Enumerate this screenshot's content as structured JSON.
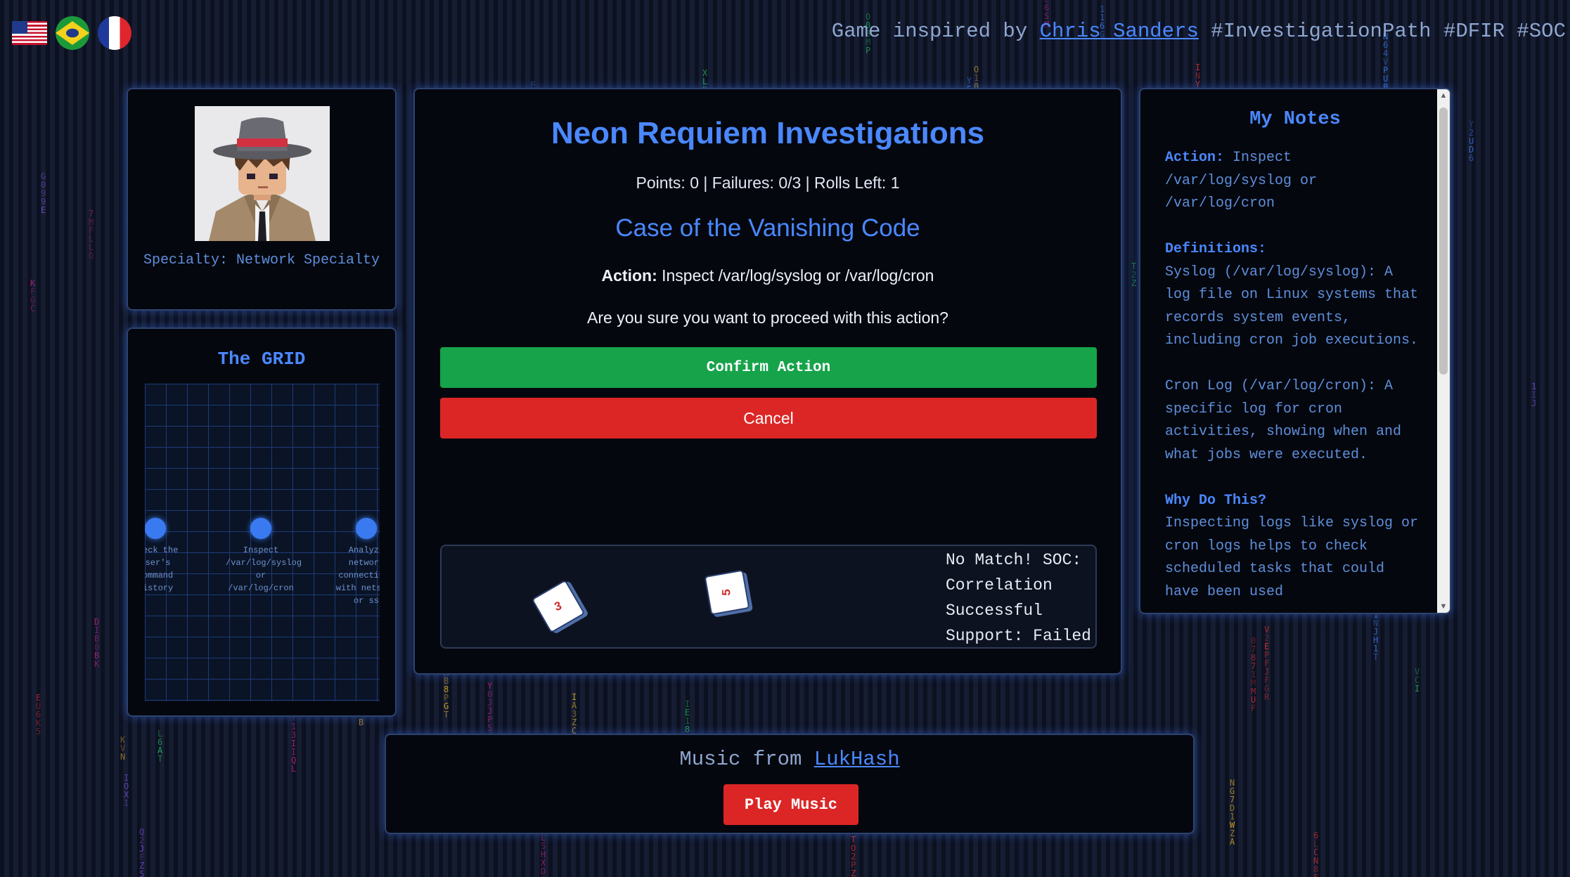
{
  "header": {
    "flags": [
      {
        "name": "us-flag-icon",
        "lang": "English"
      },
      {
        "name": "brazil-flag-icon",
        "lang": "Portuguese"
      },
      {
        "name": "france-flag-icon",
        "lang": "French"
      }
    ],
    "credit_prefix": "Game inspired by ",
    "credit_link": "Chris Sanders",
    "credit_suffix": " #InvestigationPath #DFIR #SOC"
  },
  "profile": {
    "avatar_icon": "detective-avatar-icon",
    "specialty": "Specialty: Network Specialty"
  },
  "grid": {
    "title": "The GRID",
    "nodes": [
      {
        "label": "Check the user's command history"
      },
      {
        "label": "Inspect /var/log/syslog or /var/log/cron"
      },
      {
        "label": "Analyze network connections with netstat or ss"
      }
    ]
  },
  "main": {
    "title": "Neon Requiem Investigations",
    "stats": "Points: 0 | Failures: 0/3 | Rolls Left: 1",
    "case_title": "Case of the Vanishing Code",
    "action_label": "Action:",
    "action_text": " Inspect /var/log/syslog or /var/log/cron",
    "confirm_question": "Are you sure you want to proceed with this action?",
    "confirm_button": "Confirm Action",
    "cancel_button": "Cancel",
    "dice": [
      3,
      5
    ],
    "result_lines": [
      "No Match! SOC:",
      "Correlation",
      "Successful",
      "Support: Failed"
    ]
  },
  "notes": {
    "title": "My Notes",
    "action_label": "Action:",
    "action_text": " Inspect /var/log/syslog or /var/log/cron",
    "definitions_label": "Definitions:",
    "syslog_def": "Syslog (/var/log/syslog): A log file on Linux systems that records system events, including cron job executions.",
    "cron_def": "Cron Log (/var/log/cron): A specific log for cron activities, showing when and what jobs were executed.",
    "why_label": "Why Do This?",
    "why_text": "Inspecting logs like syslog or cron logs helps to check scheduled tasks that could have been used"
  },
  "music": {
    "prefix": "Music from ",
    "link": "LukHash",
    "button": "Play Music"
  },
  "colors": {
    "accent": "#4a88ff",
    "confirm": "#16a34a",
    "cancel": "#dc2626",
    "panel_bg": "#05070e"
  }
}
